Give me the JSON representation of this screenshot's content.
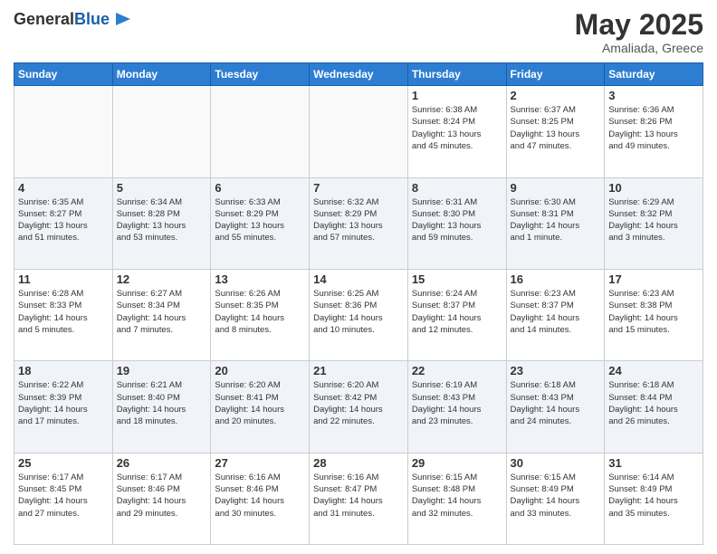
{
  "logo": {
    "general": "General",
    "blue": "Blue"
  },
  "header": {
    "title": "May 2025",
    "subtitle": "Amaliada, Greece"
  },
  "weekdays": [
    "Sunday",
    "Monday",
    "Tuesday",
    "Wednesday",
    "Thursday",
    "Friday",
    "Saturday"
  ],
  "weeks": [
    [
      {
        "day": "",
        "info": ""
      },
      {
        "day": "",
        "info": ""
      },
      {
        "day": "",
        "info": ""
      },
      {
        "day": "",
        "info": ""
      },
      {
        "day": "1",
        "info": "Sunrise: 6:38 AM\nSunset: 8:24 PM\nDaylight: 13 hours\nand 45 minutes."
      },
      {
        "day": "2",
        "info": "Sunrise: 6:37 AM\nSunset: 8:25 PM\nDaylight: 13 hours\nand 47 minutes."
      },
      {
        "day": "3",
        "info": "Sunrise: 6:36 AM\nSunset: 8:26 PM\nDaylight: 13 hours\nand 49 minutes."
      }
    ],
    [
      {
        "day": "4",
        "info": "Sunrise: 6:35 AM\nSunset: 8:27 PM\nDaylight: 13 hours\nand 51 minutes."
      },
      {
        "day": "5",
        "info": "Sunrise: 6:34 AM\nSunset: 8:28 PM\nDaylight: 13 hours\nand 53 minutes."
      },
      {
        "day": "6",
        "info": "Sunrise: 6:33 AM\nSunset: 8:29 PM\nDaylight: 13 hours\nand 55 minutes."
      },
      {
        "day": "7",
        "info": "Sunrise: 6:32 AM\nSunset: 8:29 PM\nDaylight: 13 hours\nand 57 minutes."
      },
      {
        "day": "8",
        "info": "Sunrise: 6:31 AM\nSunset: 8:30 PM\nDaylight: 13 hours\nand 59 minutes."
      },
      {
        "day": "9",
        "info": "Sunrise: 6:30 AM\nSunset: 8:31 PM\nDaylight: 14 hours\nand 1 minute."
      },
      {
        "day": "10",
        "info": "Sunrise: 6:29 AM\nSunset: 8:32 PM\nDaylight: 14 hours\nand 3 minutes."
      }
    ],
    [
      {
        "day": "11",
        "info": "Sunrise: 6:28 AM\nSunset: 8:33 PM\nDaylight: 14 hours\nand 5 minutes."
      },
      {
        "day": "12",
        "info": "Sunrise: 6:27 AM\nSunset: 8:34 PM\nDaylight: 14 hours\nand 7 minutes."
      },
      {
        "day": "13",
        "info": "Sunrise: 6:26 AM\nSunset: 8:35 PM\nDaylight: 14 hours\nand 8 minutes."
      },
      {
        "day": "14",
        "info": "Sunrise: 6:25 AM\nSunset: 8:36 PM\nDaylight: 14 hours\nand 10 minutes."
      },
      {
        "day": "15",
        "info": "Sunrise: 6:24 AM\nSunset: 8:37 PM\nDaylight: 14 hours\nand 12 minutes."
      },
      {
        "day": "16",
        "info": "Sunrise: 6:23 AM\nSunset: 8:37 PM\nDaylight: 14 hours\nand 14 minutes."
      },
      {
        "day": "17",
        "info": "Sunrise: 6:23 AM\nSunset: 8:38 PM\nDaylight: 14 hours\nand 15 minutes."
      }
    ],
    [
      {
        "day": "18",
        "info": "Sunrise: 6:22 AM\nSunset: 8:39 PM\nDaylight: 14 hours\nand 17 minutes."
      },
      {
        "day": "19",
        "info": "Sunrise: 6:21 AM\nSunset: 8:40 PM\nDaylight: 14 hours\nand 18 minutes."
      },
      {
        "day": "20",
        "info": "Sunrise: 6:20 AM\nSunset: 8:41 PM\nDaylight: 14 hours\nand 20 minutes."
      },
      {
        "day": "21",
        "info": "Sunrise: 6:20 AM\nSunset: 8:42 PM\nDaylight: 14 hours\nand 22 minutes."
      },
      {
        "day": "22",
        "info": "Sunrise: 6:19 AM\nSunset: 8:43 PM\nDaylight: 14 hours\nand 23 minutes."
      },
      {
        "day": "23",
        "info": "Sunrise: 6:18 AM\nSunset: 8:43 PM\nDaylight: 14 hours\nand 24 minutes."
      },
      {
        "day": "24",
        "info": "Sunrise: 6:18 AM\nSunset: 8:44 PM\nDaylight: 14 hours\nand 26 minutes."
      }
    ],
    [
      {
        "day": "25",
        "info": "Sunrise: 6:17 AM\nSunset: 8:45 PM\nDaylight: 14 hours\nand 27 minutes."
      },
      {
        "day": "26",
        "info": "Sunrise: 6:17 AM\nSunset: 8:46 PM\nDaylight: 14 hours\nand 29 minutes."
      },
      {
        "day": "27",
        "info": "Sunrise: 6:16 AM\nSunset: 8:46 PM\nDaylight: 14 hours\nand 30 minutes."
      },
      {
        "day": "28",
        "info": "Sunrise: 6:16 AM\nSunset: 8:47 PM\nDaylight: 14 hours\nand 31 minutes."
      },
      {
        "day": "29",
        "info": "Sunrise: 6:15 AM\nSunset: 8:48 PM\nDaylight: 14 hours\nand 32 minutes."
      },
      {
        "day": "30",
        "info": "Sunrise: 6:15 AM\nSunset: 8:49 PM\nDaylight: 14 hours\nand 33 minutes."
      },
      {
        "day": "31",
        "info": "Sunrise: 6:14 AM\nSunset: 8:49 PM\nDaylight: 14 hours\nand 35 minutes."
      }
    ]
  ]
}
